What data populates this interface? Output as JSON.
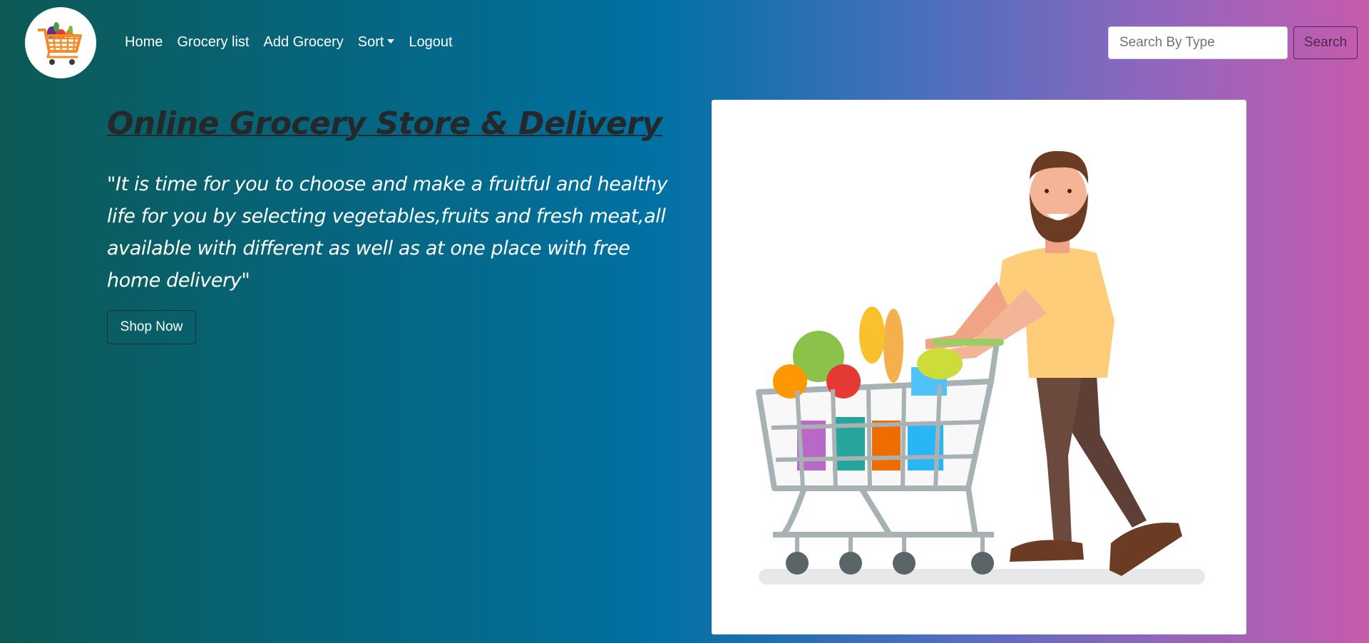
{
  "nav": {
    "logo_icon": "grocery-cart-logo",
    "links": [
      "Home",
      "Grocery list",
      "Add Grocery",
      "Sort",
      "Logout"
    ],
    "search": {
      "placeholder": "Search By Type",
      "value": "",
      "button_label": "Search"
    }
  },
  "hero": {
    "title": "Online Grocery Store & Delivery",
    "quote": "\"It is time for you to choose and make a fruitful and healthy life for you by selecting vegetables,fruits and fresh meat,all available with different as well as at one place with free home delivery\"",
    "cta_label": "Shop Now",
    "image_icon": "shopper-with-cart-illustration"
  },
  "colors": {
    "gradient_start": "#0b5a55",
    "gradient_mid": "#0071a3",
    "gradient_end": "#c75bae",
    "title_color": "#24282b",
    "search_button_color": "#4a2a4c"
  }
}
